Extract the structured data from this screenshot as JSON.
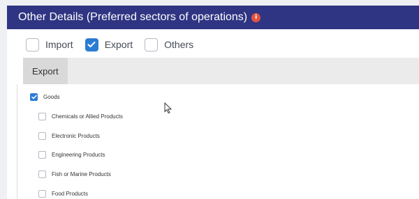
{
  "header": {
    "title": "Other Details (Preferred sectors of operations)",
    "info_icon": "info-icon",
    "bg_color": "#2f3582",
    "icon_color": "#e2533f"
  },
  "options": [
    {
      "label": "Import",
      "checked": false
    },
    {
      "label": "Export",
      "checked": true
    },
    {
      "label": "Others",
      "checked": false
    }
  ],
  "section_tab": {
    "label": "Export"
  },
  "tree": {
    "parent": {
      "label": "Goods",
      "checked": true
    },
    "children": [
      {
        "label": "Chemicals or Allied Products",
        "checked": false
      },
      {
        "label": "Electronic Products",
        "checked": false
      },
      {
        "label": "Engineering Products",
        "checked": false
      },
      {
        "label": "Fish or Marine Products",
        "checked": false
      },
      {
        "label": "Food Products",
        "checked": false
      }
    ]
  },
  "accent_color": "#2b7cd3"
}
